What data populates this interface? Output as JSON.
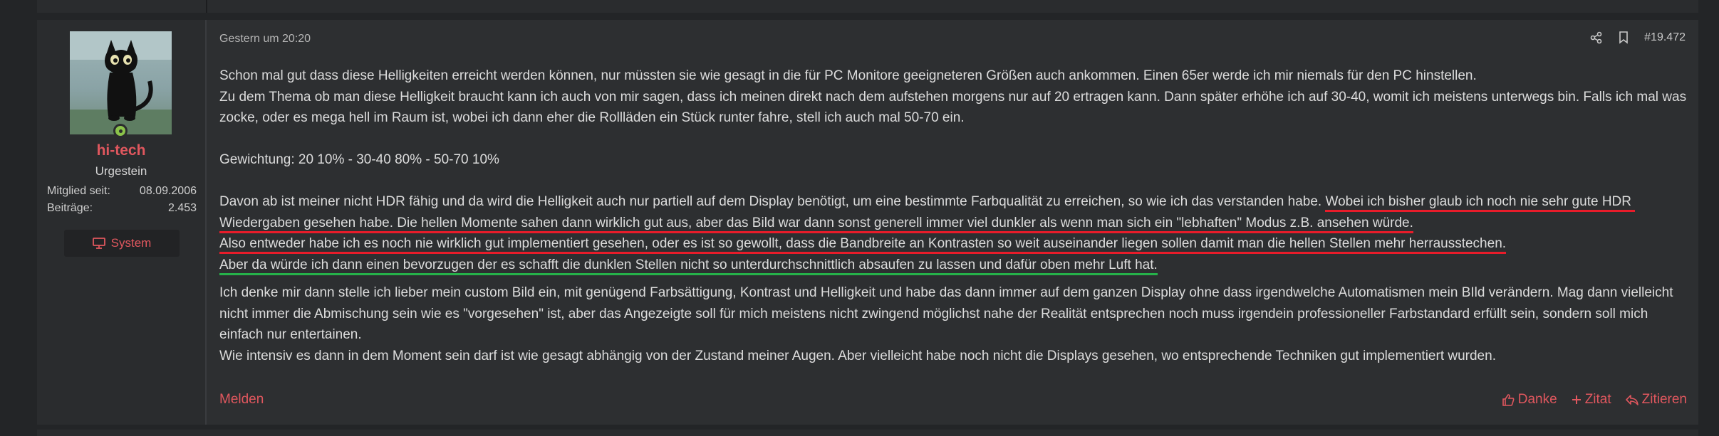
{
  "user": {
    "username": "hi-tech",
    "rank": "Urgestein",
    "stats": [
      {
        "label": "Mitglied seit:",
        "value": "08.09.2006"
      },
      {
        "label": "Beiträge:",
        "value": "2.453"
      }
    ],
    "system_button": "System",
    "online_color": "#8bc34a"
  },
  "post": {
    "date": "Gestern um 20:20",
    "number": "#19.472",
    "icons": [
      "share-icon",
      "bookmark-icon"
    ],
    "paragraphs": {
      "p1": "Schon mal gut dass diese Helligkeiten erreicht werden können, nur müssten sie wie gesagt in die für PC Monitore geeigneteren Größen auch ankommen. Einen 65er werde ich mir niemals für den PC hinstellen.",
      "p2": "Zu dem Thema ob man diese Helligkeit braucht kann ich auch von mir sagen, dass ich meinen direkt nach dem aufstehen morgens nur auf 20 ertragen kann. Dann später erhöhe ich auf 30-40, womit ich meistens unterwegs bin. Falls ich mal was zocke, oder es mega hell im Raum ist, wobei ich dann eher die Rollläden ein Stück runter fahre, stell ich auch mal 50-70 ein.",
      "p3": "Gewichtung: 20 10% - 30-40 80% - 50-70 10%",
      "p4a": "Davon ab ist meiner nicht HDR fähig und da wird die Helligkeit auch nur partiell auf dem Display benötigt, um eine bestimmte Farbqualität zu erreichen, so wie ich das verstanden habe. ",
      "p4b": "Wobei ich bisher glaub ich noch nie sehr gute HDR Wiedergaben gesehen habe. Die hellen Momente sahen dann wirklich gut aus, aber das Bild war dann sonst generell immer viel dunkler als wenn man sich ein \"lebhaften\" Modus z.B. ansehen würde.",
      "p4c": "Also entweder habe ich es noch nie wirklich gut implementiert gesehen, oder es ist so gewollt, dass die Bandbreite an Kontrasten so weit auseinander liegen sollen damit man die hellen Stellen mehr herrausstechen.",
      "p4d": "Aber da würde ich dann einen bevorzugen der es schafft die dunklen Stellen nicht so unterdurchschnittlich absaufen zu lassen und dafür oben mehr Luft hat.",
      "p5": "Ich denke mir dann stelle ich lieber mein custom Bild ein, mit genügend Farbsättigung, Kontrast und Helligkeit und habe das dann immer auf dem ganzen Display ohne dass irgendwelche Automatismen mein BIld verändern. Mag dann vielleicht nicht immer die Abmischung sein wie es \"vorgesehen\" ist, aber das Angezeigte soll für mich meistens nicht zwingend möglichst nahe der Realität entsprechen noch muss irgendein professioneller Farbstandard erfüllt sein, sondern soll mich einfach nur entertainen.",
      "p6": "Wie intensiv es dann in dem Moment sein darf ist wie gesagt abhängig von der Zustand meiner Augen. Aber vielleicht habe noch nicht die Displays gesehen, wo entsprechende Techniken gut implementiert wurden."
    },
    "annotation_colors": {
      "red": "#e81c2a",
      "yellow": "#e8d21c",
      "green": "#26b24a"
    }
  },
  "footer": {
    "report": "Melden",
    "thanks": "Danke",
    "quote": "Zitat",
    "reply": "Zitieren"
  },
  "colors": {
    "accent": "#e0575e",
    "background": "#232527",
    "panel": "#2d2f31"
  }
}
